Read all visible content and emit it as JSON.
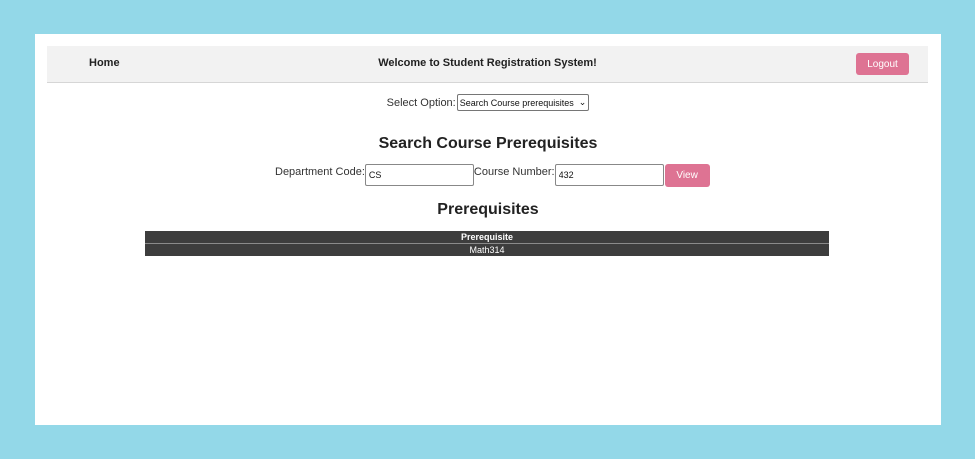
{
  "navbar": {
    "home_label": "Home",
    "title": "Welcome to Student Registration System!",
    "logout_label": "Logout"
  },
  "option_select": {
    "label": "Select Option:",
    "selected": "Search Course prerequisites"
  },
  "search": {
    "heading": "Search Course Prerequisites",
    "department_label": "Department Code:",
    "department_value": "CS",
    "course_label": "Course Number:",
    "course_value": "432",
    "view_label": "View"
  },
  "results": {
    "heading": "Prerequisites",
    "columns": [
      "Prerequisite"
    ],
    "rows": [
      [
        "Math314"
      ]
    ]
  },
  "colors": {
    "backdrop": "#93d8e8",
    "accent_button": "#de7393",
    "table_bg": "#3d3d3d"
  }
}
